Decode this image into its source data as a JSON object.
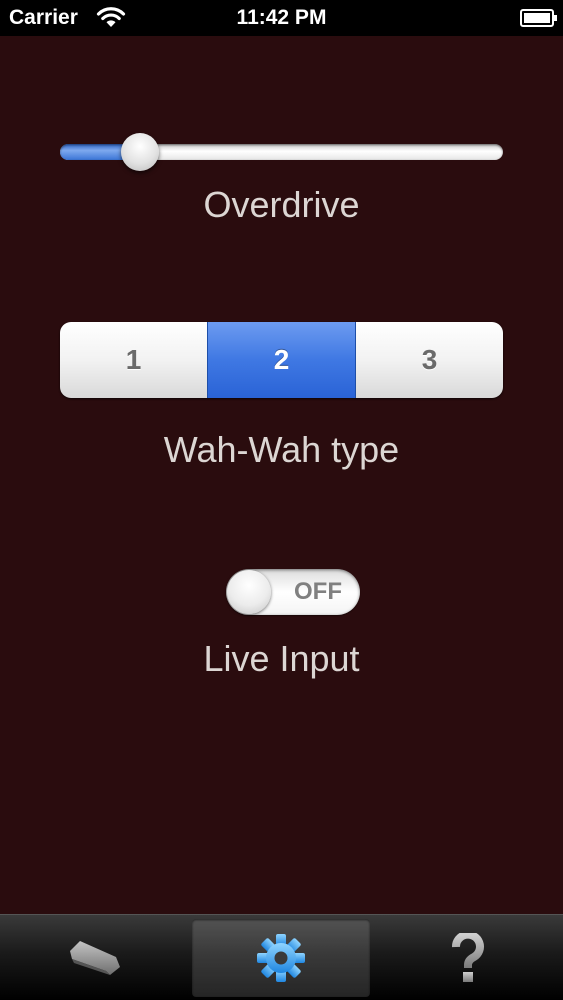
{
  "status_bar": {
    "carrier": "Carrier",
    "time": "11:42 PM"
  },
  "overdrive": {
    "label": "Overdrive",
    "value_fraction": 0.18
  },
  "wah_wah": {
    "label": "Wah-Wah type",
    "options": [
      "1",
      "2",
      "3"
    ],
    "selected_index": 1
  },
  "live_input": {
    "label": "Live Input",
    "state_text": "OFF"
  },
  "tab_bar": {
    "tabs": [
      {
        "icon": "pedal-icon"
      },
      {
        "icon": "gear-icon",
        "selected": true
      },
      {
        "icon": "question-mark-icon"
      }
    ]
  },
  "colors": {
    "background": "#2a0c0e",
    "accent_blue": "#3f78e3",
    "label_text": "#dcd6d3",
    "tab_icon_selected": "#3fa9f5",
    "tab_icon_inactive": "#9b9b9b"
  }
}
